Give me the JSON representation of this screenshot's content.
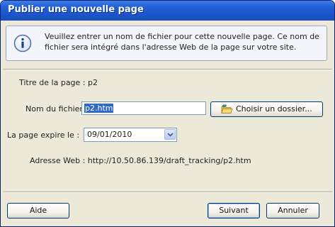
{
  "window": {
    "title": "Publier une nouvelle page"
  },
  "info": {
    "icon": "info-icon",
    "message": "Veuillez entrer un nom de fichier pour cette nouvelle page. Ce nom de fichier sera intégré dans l'adresse Web de la page sur votre site."
  },
  "form": {
    "page_title_label": "Titre de la page : p2",
    "filename_label": "Nom du fichier :",
    "filename_value": "p2.htm",
    "choose_folder_label": "Choisir un dossier...",
    "expires_label": "La page expire le :",
    "expires_value": "09/01/2010",
    "web_address_label": "Adresse Web : http://10.50.86.139/draft_tracking/p2.htm"
  },
  "buttons": {
    "help": "Aide",
    "next": "Suivant",
    "cancel": "Annuler"
  },
  "colors": {
    "titlebar": "#2461d6",
    "dialog_bg": "#ece9d8",
    "selection": "#316ac5"
  }
}
